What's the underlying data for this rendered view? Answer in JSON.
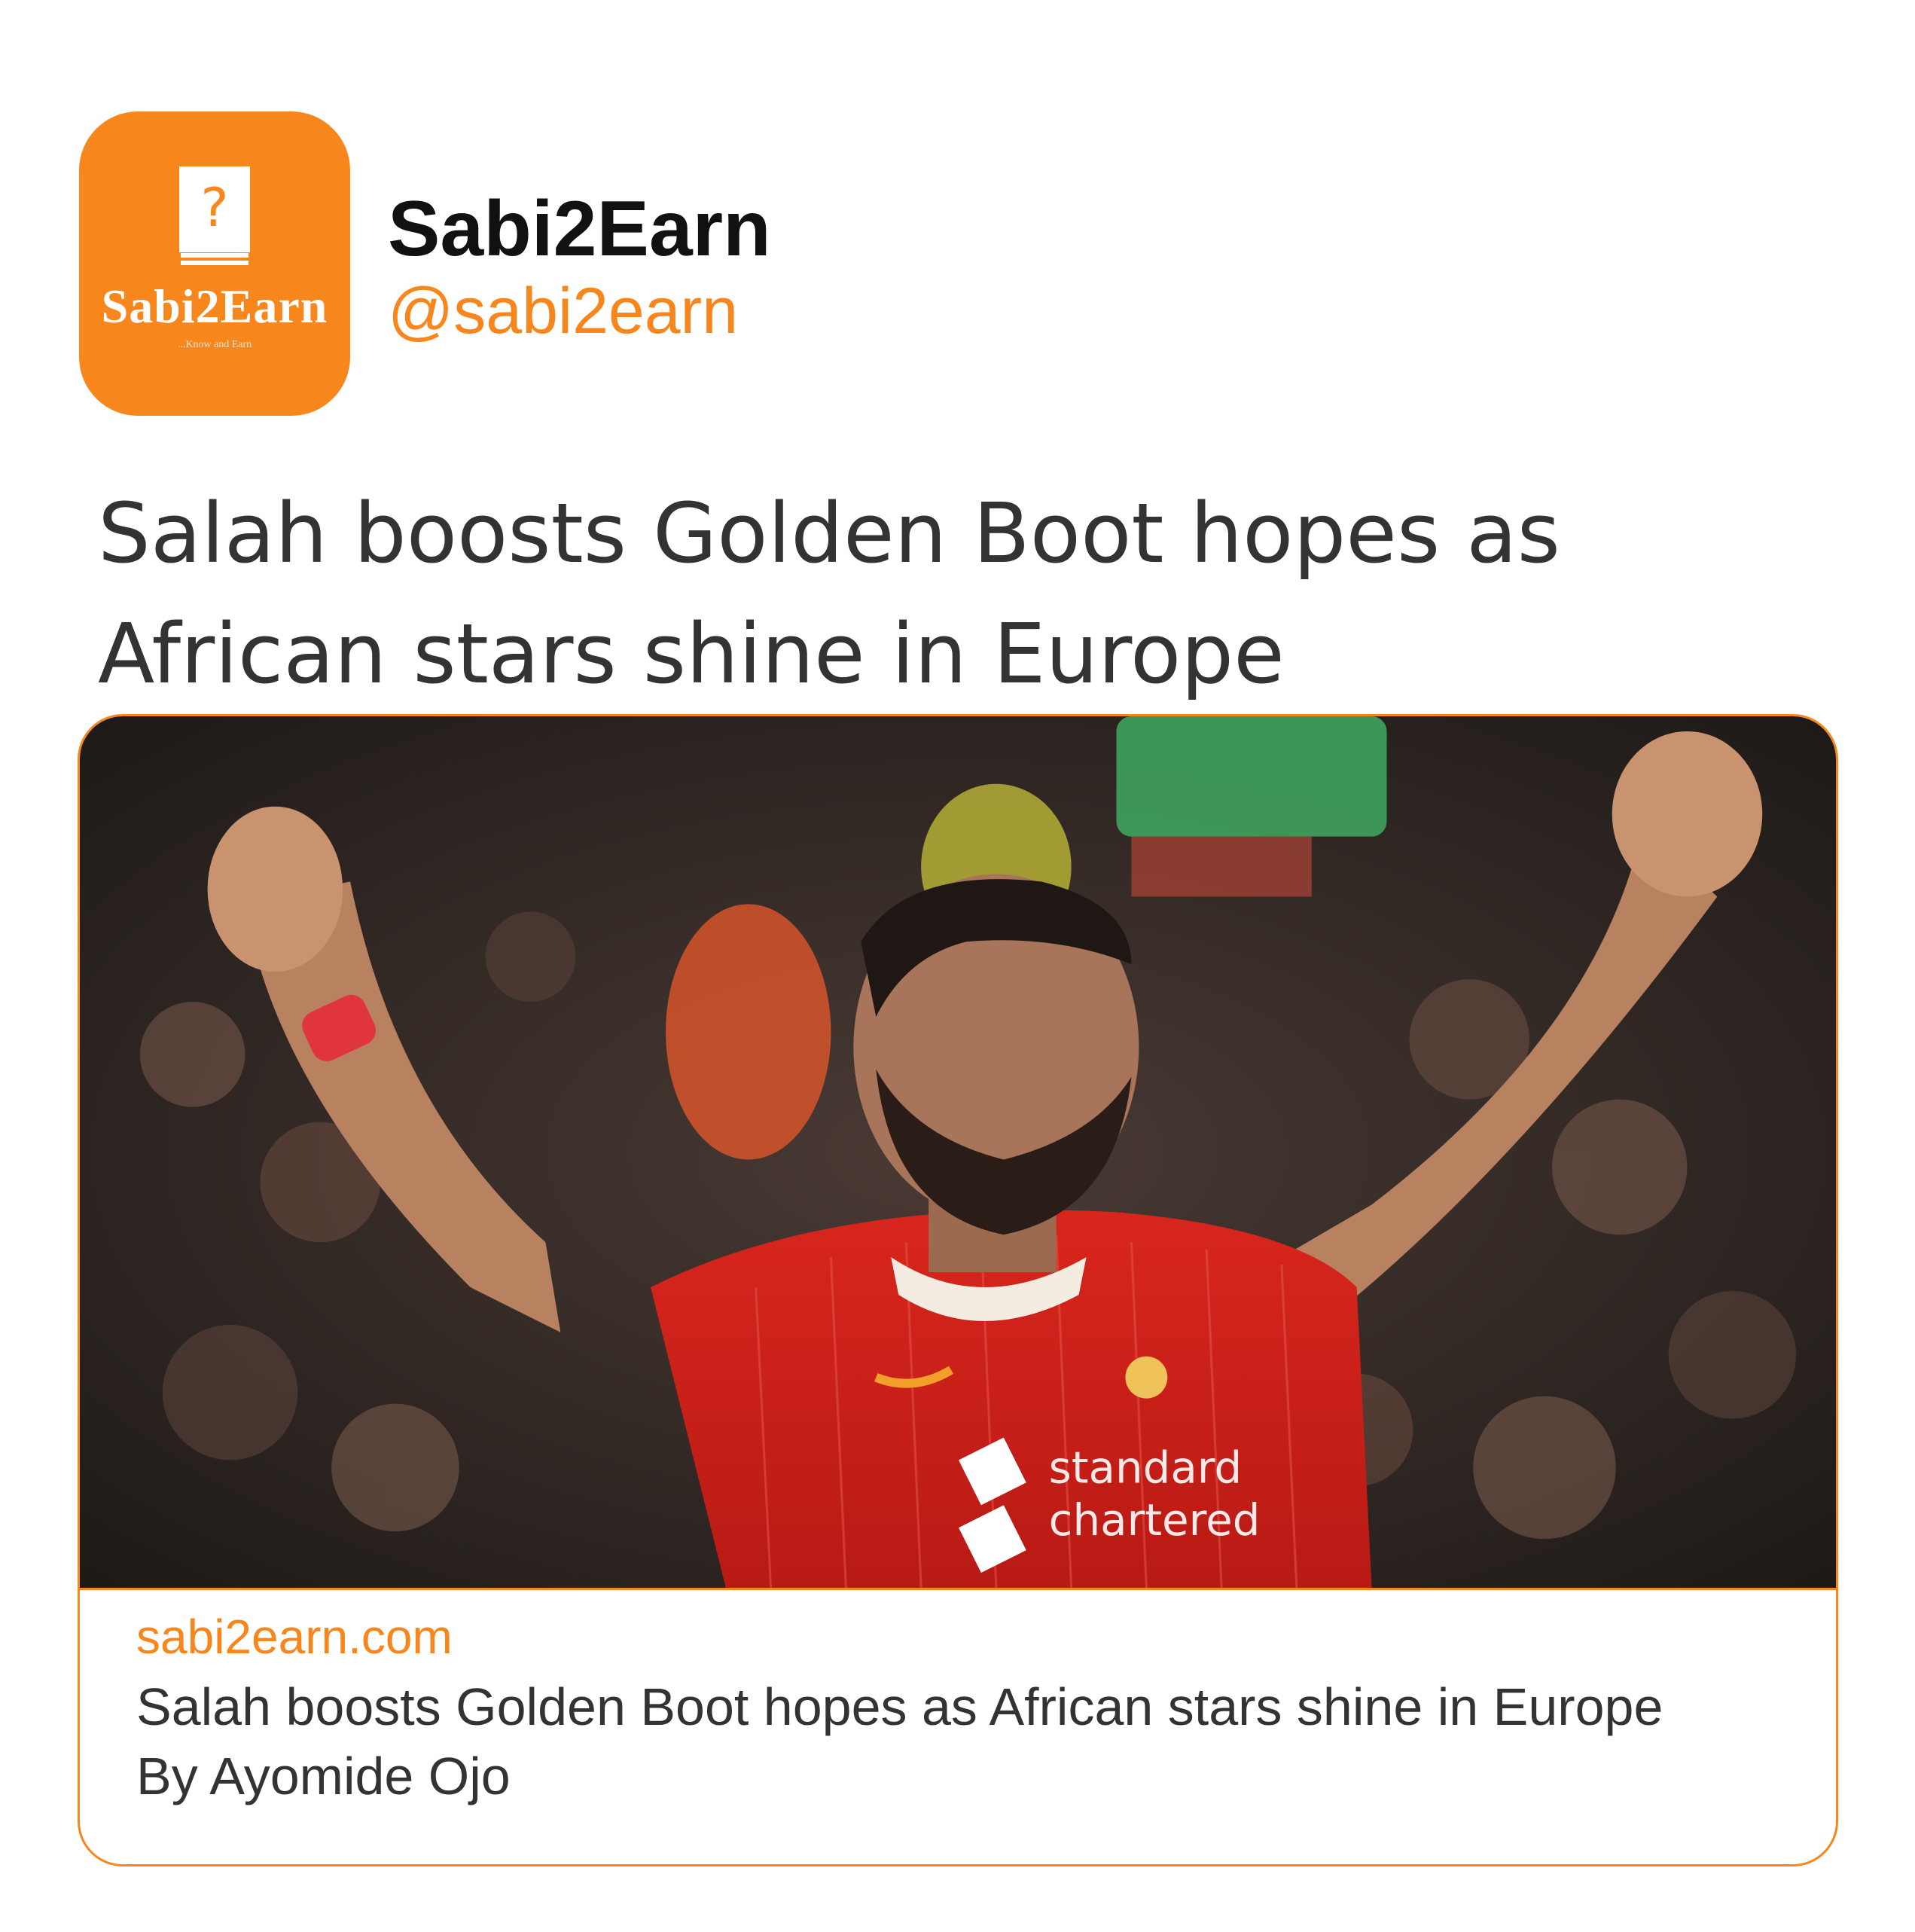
{
  "colors": {
    "accent": "#f7861d",
    "text": "#333333"
  },
  "account": {
    "avatar_name": "Sabi2Earn",
    "avatar_tagline": "...Know and Earn",
    "name": "Sabi2Earn",
    "handle": "@sabi2earn"
  },
  "post": {
    "headline": "Salah boosts Golden Boot hopes as African stars shine in Europe"
  },
  "card": {
    "image_description": "Liverpool player celebrating with arms outstretched in front of crowd",
    "sponsor_text_1": "standard",
    "sponsor_text_2": "chartered",
    "domain": "sabi2earn.com",
    "title": "Salah boosts Golden Boot hopes as African stars shine in Europe",
    "byline": "By Ayomide Ojo"
  }
}
